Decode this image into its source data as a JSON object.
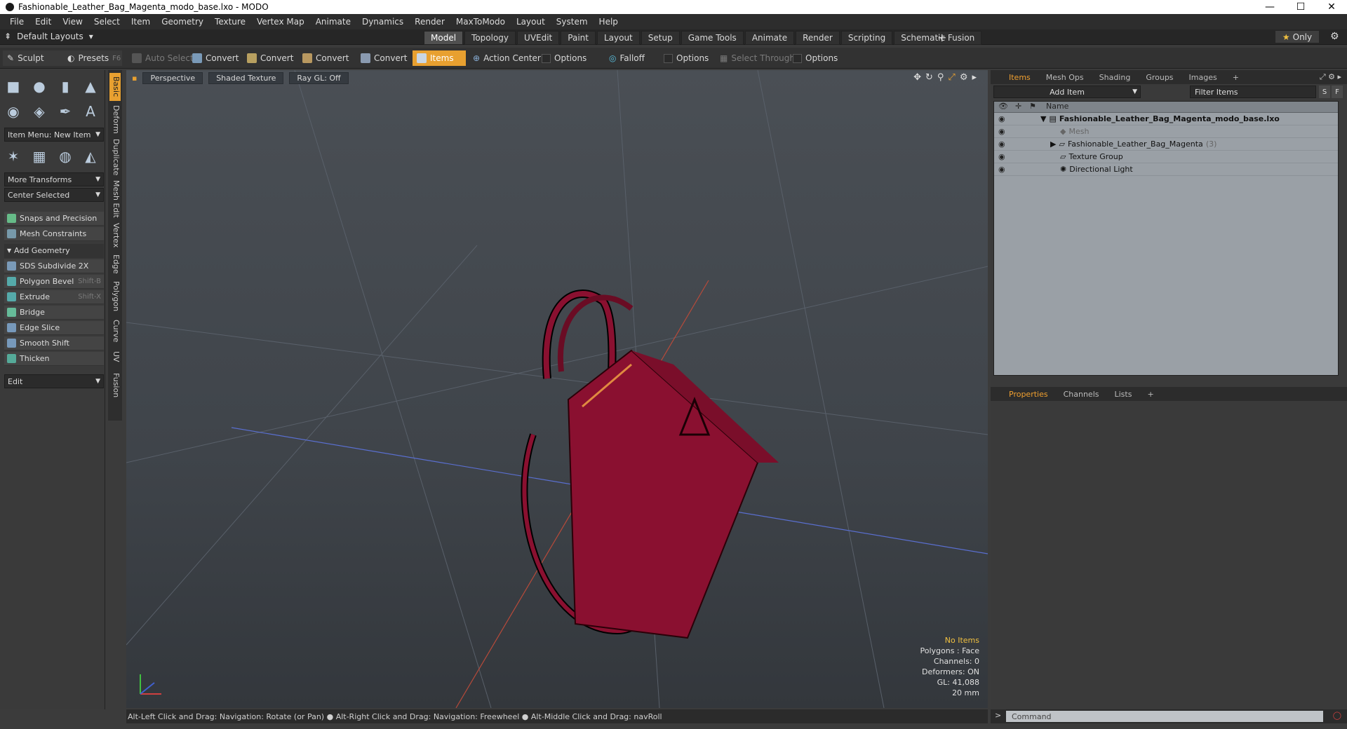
{
  "window": {
    "title": "Fashionable_Leather_Bag_Magenta_modo_base.lxo - MODO",
    "minimize": "—",
    "maximize": "☐",
    "close": "✕"
  },
  "menu": [
    "File",
    "Edit",
    "View",
    "Select",
    "Item",
    "Geometry",
    "Texture",
    "Vertex Map",
    "Animate",
    "Dynamics",
    "Render",
    "MaxToModo",
    "Layout",
    "System",
    "Help"
  ],
  "layoutbar": {
    "layouts_label": "Default Layouts",
    "tabs": [
      "Model",
      "Topology",
      "UVEdit",
      "Paint",
      "Layout",
      "Setup",
      "Game Tools",
      "Animate",
      "Render",
      "Scripting",
      "Schematic Fusion"
    ],
    "active_tab": "Model",
    "only_label": "Only"
  },
  "toolbar": {
    "sculpt": "Sculpt",
    "presets": "Presets",
    "presets_key": "F6",
    "auto_select": "Auto Select",
    "convert": "Convert",
    "items": "Items",
    "action_center": "Action Center",
    "options": "Options",
    "falloff": "Falloff",
    "select_through": "Select Through"
  },
  "left": {
    "item_menu": "Item Menu: New Item",
    "more_transforms": "More Transforms",
    "center_selected": "Center Selected",
    "snaps": "Snaps and Precision",
    "mesh_constraints": "Mesh Constraints",
    "add_geometry": "Add Geometry",
    "tools": [
      {
        "label": "SDS Subdivide 2X",
        "shortcut": ""
      },
      {
        "label": "Polygon Bevel",
        "shortcut": "Shift-B"
      },
      {
        "label": "Extrude",
        "shortcut": "Shift-X"
      },
      {
        "label": "Bridge",
        "shortcut": ""
      },
      {
        "label": "Edge Slice",
        "shortcut": ""
      },
      {
        "label": "Smooth Shift",
        "shortcut": ""
      },
      {
        "label": "Thicken",
        "shortcut": ""
      }
    ],
    "edit": "Edit",
    "vtabs": [
      "Basic",
      "Deform",
      "Duplicate",
      "Mesh Edit",
      "Vertex",
      "Edge",
      "Polygon",
      "Curve",
      "UV",
      "Fusion"
    ]
  },
  "viewport": {
    "perspective": "Perspective",
    "shading": "Shaded Texture",
    "raygl": "Ray GL: Off",
    "stats": {
      "no_items": "No Items",
      "polygons": "Polygons : Face",
      "channels": "Channels: 0",
      "deformers": "Deformers: ON",
      "gl": "GL: 41,088",
      "size": "20 mm"
    },
    "bag_color": "#8a1030"
  },
  "status": "Alt-Left Click and Drag: Navigation: Rotate (or Pan) ● Alt-Right Click and Drag: Navigation: Freewheel ● Alt-Middle Click and Drag: navRoll",
  "items_panel": {
    "tabs": [
      "Items",
      "Mesh Ops",
      "Shading",
      "Groups",
      "Images"
    ],
    "add_item": "Add Item",
    "filter": "Filter Items",
    "s_btn": "S",
    "f_btn": "F",
    "name_col": "Name",
    "tree": [
      {
        "label": "Fashionable_Leather_Bag_Magenta_modo_base.lxo",
        "count": ""
      },
      {
        "label": "Mesh",
        "count": ""
      },
      {
        "label": "Fashionable_Leather_Bag_Magenta",
        "count": "(3)"
      },
      {
        "label": "Texture Group",
        "count": ""
      },
      {
        "label": "Directional Light",
        "count": ""
      }
    ]
  },
  "props_panel": {
    "tabs": [
      "Properties",
      "Channels",
      "Lists"
    ]
  },
  "command": {
    "placeholder": "Command"
  }
}
